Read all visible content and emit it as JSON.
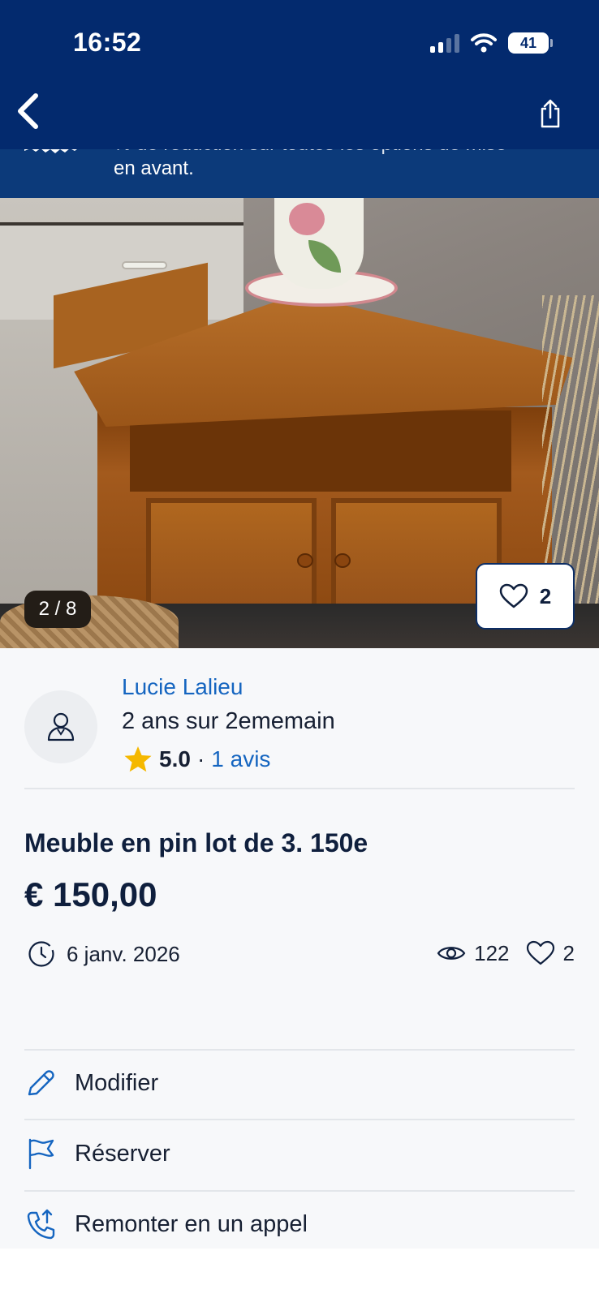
{
  "status_bar": {
    "time": "16:52",
    "battery": "41"
  },
  "promo": {
    "line1": "% de réduction sur toutes les options de mise",
    "line2": "en avant."
  },
  "gallery": {
    "counter": "2 / 8",
    "favorites": "2"
  },
  "seller": {
    "name": "Lucie Lalieu",
    "since": "2 ans sur 2ememain",
    "rating": "5.0",
    "separator": "·",
    "reviews": "1 avis"
  },
  "listing": {
    "title": "Meuble en pin lot de 3. 150e",
    "price": "€ 150,00",
    "date": "6 janv. 2026",
    "views": "122",
    "likes": "2"
  },
  "actions": [
    {
      "label": "Modifier",
      "icon": "pencil-icon"
    },
    {
      "label": "Réserver",
      "icon": "flag-icon"
    },
    {
      "label": "Remonter en un appel",
      "icon": "phone-arrow-icon"
    }
  ],
  "colors": {
    "header": "#032a6e",
    "link": "#1565c0",
    "icon": "#1565c0",
    "star": "#f5b800"
  }
}
